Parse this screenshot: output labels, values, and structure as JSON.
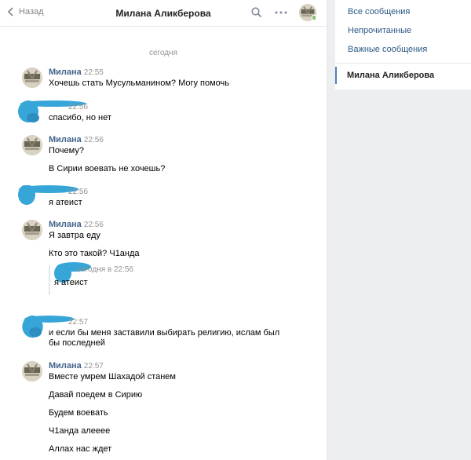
{
  "header": {
    "back_label": "Назад",
    "title": "Милана Аликберова"
  },
  "date_separator": "сегодня",
  "messages": [
    {
      "author": "Милана",
      "time": "22:55",
      "lines": [
        "Хочешь стать Мусульманином? Могу помочь"
      ]
    },
    {
      "author": "",
      "time": "22:56",
      "lines": [
        "спасибо, но нет"
      ]
    },
    {
      "author": "Милана",
      "time": "22:56",
      "lines": [
        "Почему?",
        "В Сирии воевать не хочешь?"
      ]
    },
    {
      "author": "",
      "time": "22:56",
      "lines": [
        "я атеист"
      ]
    },
    {
      "author": "Милана",
      "time": "22:56",
      "lines": [
        "Я завтра еду",
        "Кто это такой? Ч1анда"
      ],
      "forwarded": {
        "time": "сегодня в 22:56",
        "text": "я атеист"
      }
    },
    {
      "author": "",
      "time": "22:57",
      "lines": [
        "и если бы меня заставили выбирать религию, ислам был бы последней"
      ]
    },
    {
      "author": "Милана",
      "time": "22:57",
      "lines": [
        "Вместе умрем Шахадой станем",
        "Давай поедем в Сирию",
        "Будем воевать",
        "Ч1анда алееее",
        "Аллах нас ждет"
      ]
    }
  ],
  "sidebar": {
    "items": [
      "Все сообщения",
      "Непрочитанные",
      "Важные сообщения"
    ],
    "active": "Милана Аликберова"
  },
  "colors": {
    "link": "#2a5885",
    "author": "#42648b",
    "online": "#8ac176",
    "scribble": "#36a5d8"
  },
  "icons": [
    "back-chevron-icon",
    "search-icon",
    "more-icon",
    "online-mobile-icon"
  ]
}
